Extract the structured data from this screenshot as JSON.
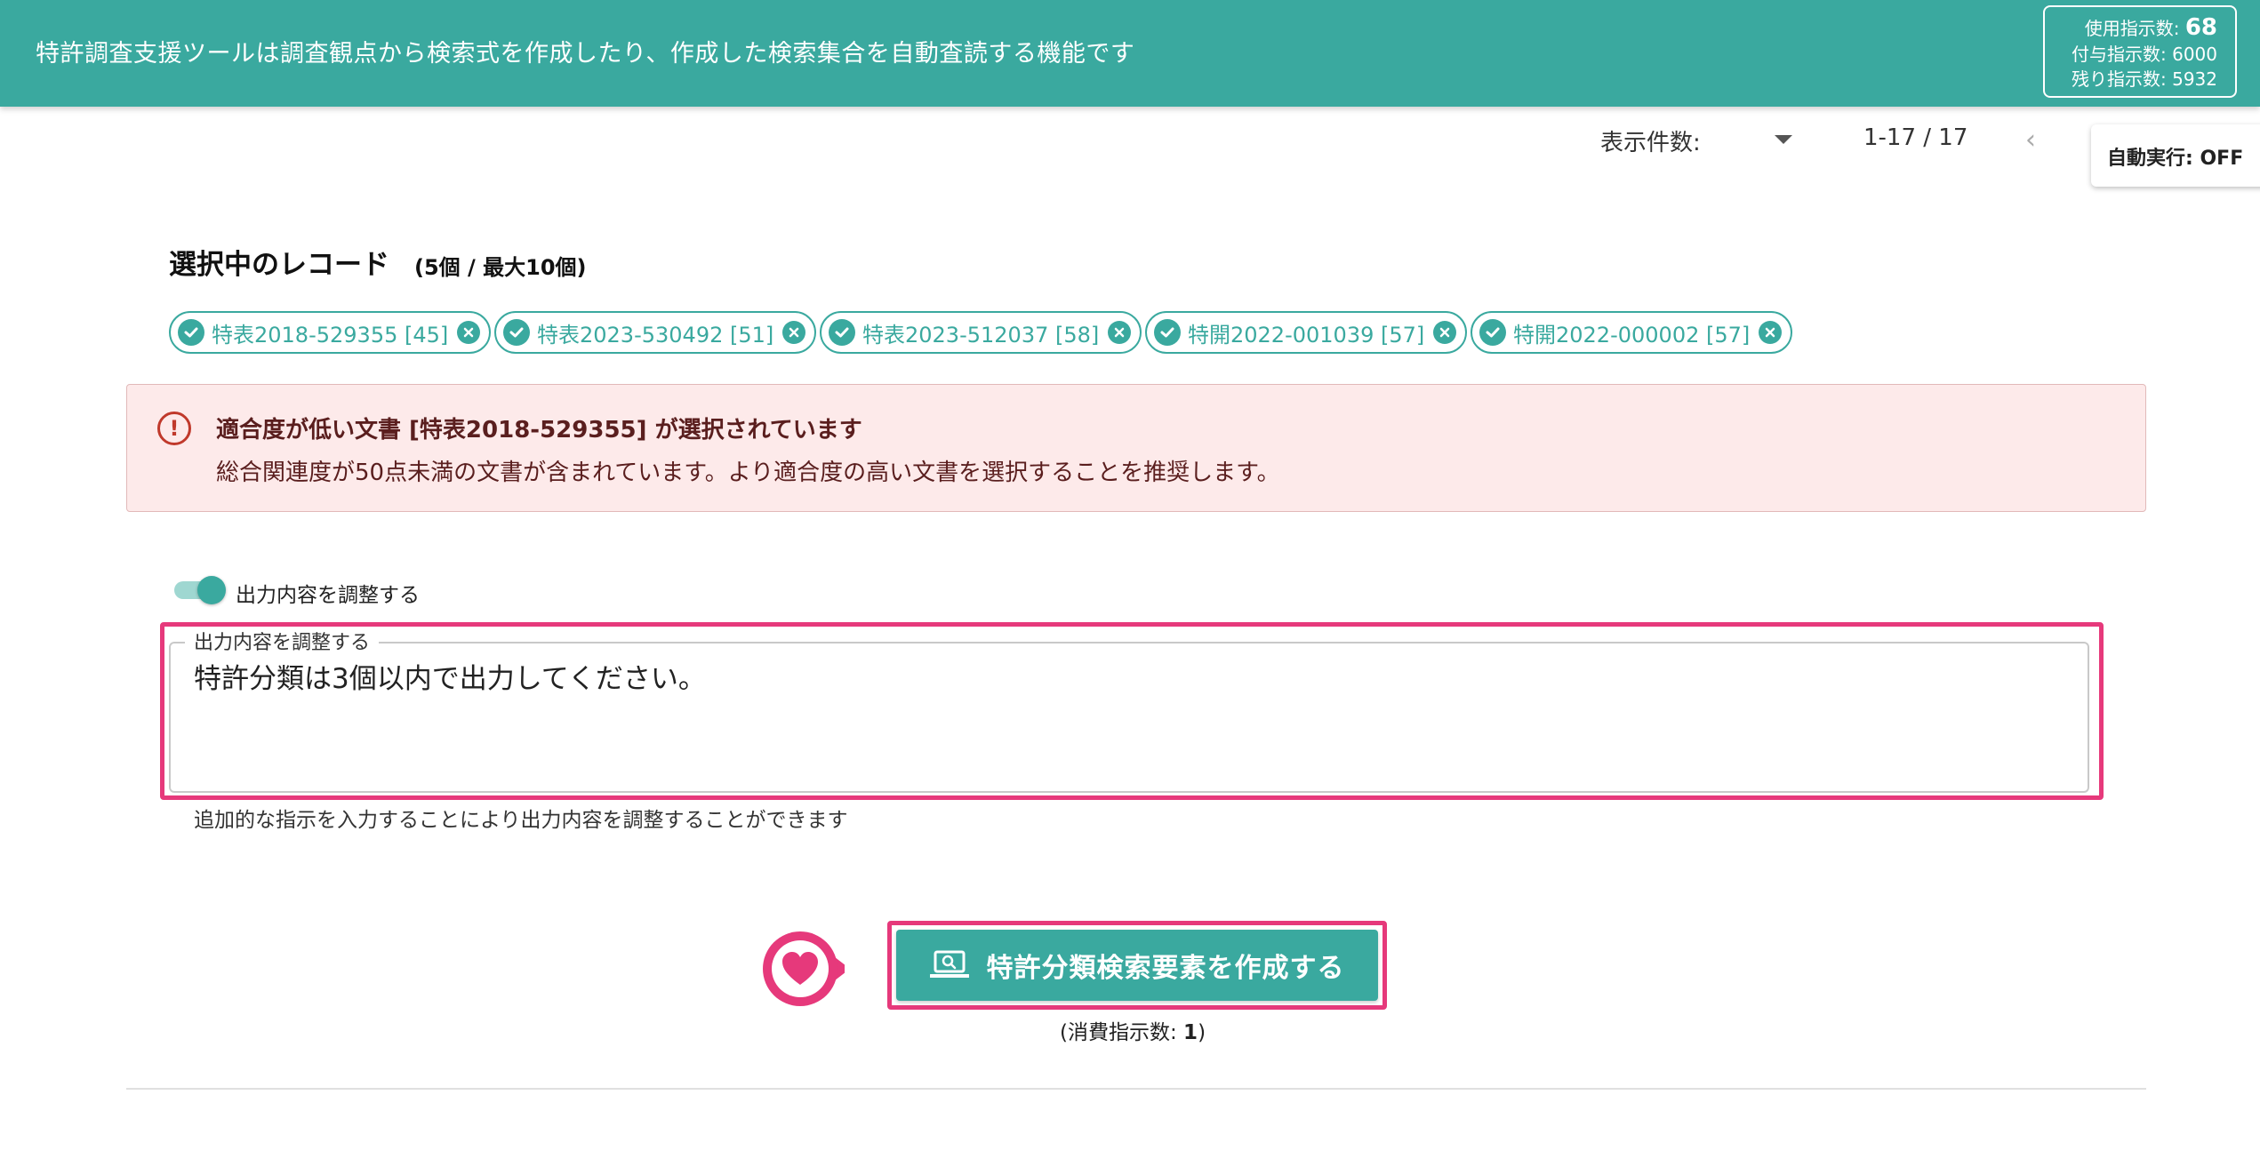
{
  "header": {
    "title": "特許調査支援ツールは調査観点から検索式を作成したり、作成した検索集合を自動査読する機能です",
    "usage": {
      "used_label": "使用指示数:",
      "used_value": "68",
      "granted_label": "付与指示数:",
      "granted_value": "6000",
      "remaining_label": "残り指示数:",
      "remaining_value": "5932"
    }
  },
  "controls": {
    "per_page_label": "表示件数:",
    "range": "1-17 / 17",
    "auto_run": "自動実行: OFF"
  },
  "selected": {
    "title": "選択中のレコード",
    "count": "(5個 / 最大10個)",
    "chips": [
      {
        "label": "特表2018-529355 [45]"
      },
      {
        "label": "特表2023-530492 [51]"
      },
      {
        "label": "特表2023-512037 [58]"
      },
      {
        "label": "特開2022-001039 [57]"
      },
      {
        "label": "特開2022-000002 [57]"
      }
    ]
  },
  "alert": {
    "title": "適合度が低い文書 [特表2018-529355] が選択されています",
    "body": "総合関連度が50点未満の文書が含まれています。より適合度の高い文書を選択することを推奨します。",
    "icon_glyph": "!"
  },
  "adjust": {
    "toggle_label": "出力内容を調整する",
    "toggle_on": true,
    "field_label": "出力内容を調整する",
    "field_value": "特許分類は3個以内で出力してください。",
    "helper": "追加的な指示を入力することにより出力内容を調整することができます"
  },
  "action": {
    "button_label": "特許分類検索要素を作成する",
    "consume_prefix": "(消費指示数: ",
    "consume_value": "1",
    "consume_suffix": ")"
  },
  "colors": {
    "primary": "#3aa99f",
    "highlight": "#e6397b",
    "alert_bg": "#fdeaea",
    "alert_text": "#5a1e1e"
  }
}
